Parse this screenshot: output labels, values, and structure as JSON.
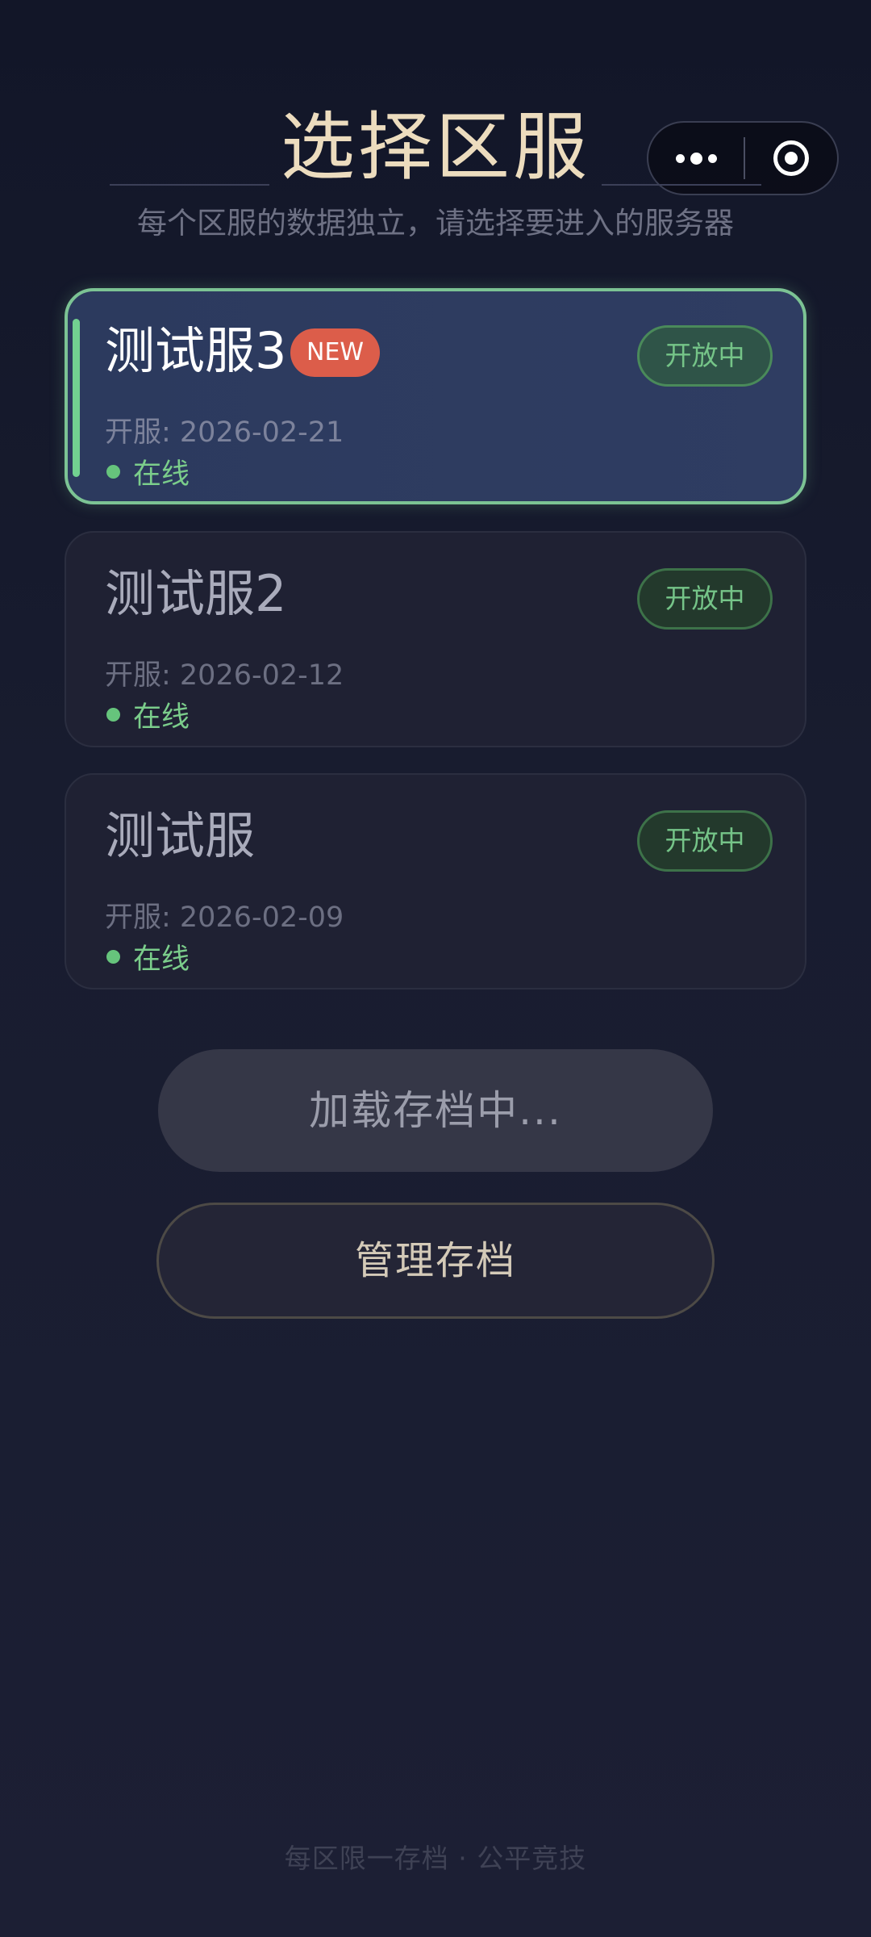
{
  "header": {
    "title": "选择区服",
    "subtitle": "每个区服的数据独立，请选择要进入的服务器"
  },
  "capsule": {
    "more_icon": "more-dots-icon",
    "close_icon": "target-circle-icon"
  },
  "servers": [
    {
      "name": "测试服3",
      "badge": "NEW",
      "status": "开放中",
      "date": "开服: 2026-02-21",
      "online": "在线",
      "selected": true
    },
    {
      "name": "测试服2",
      "status": "开放中",
      "date": "开服: 2026-02-12",
      "online": "在线",
      "selected": false
    },
    {
      "name": "测试服",
      "status": "开放中",
      "date": "开服: 2026-02-09",
      "online": "在线",
      "selected": false
    }
  ],
  "buttons": {
    "loading_label": "加载存档中...",
    "manage_label": "管理存档"
  },
  "footer": {
    "text": "每区限一存档 · 公平竞技"
  },
  "colors": {
    "accent_green": "#72d190",
    "title_gold": "#ecdcbe",
    "badge_red": "#dc5d4a",
    "background": "#171a2d"
  }
}
